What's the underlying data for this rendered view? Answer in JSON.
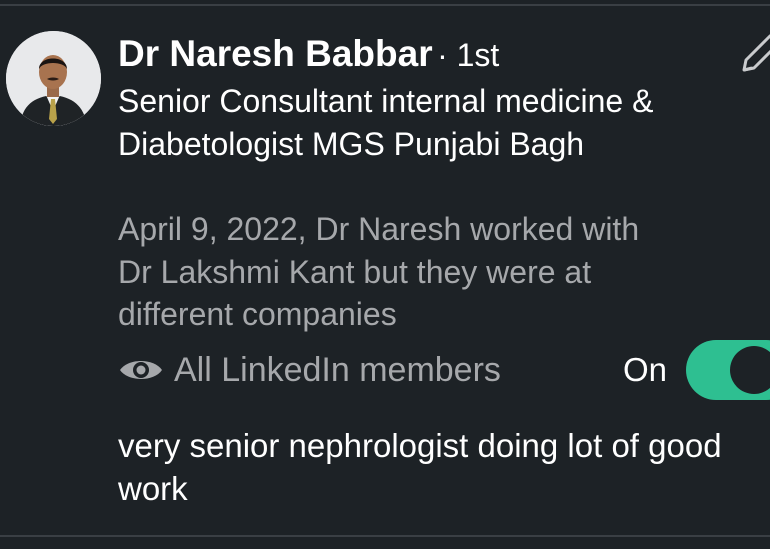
{
  "connection": {
    "name": "Dr Naresh Babbar",
    "degree": "· 1st",
    "headline": "Senior Consultant internal medicine & Diabetologist MGS Punjabi Bagh",
    "context": "April 9, 2022, Dr Naresh worked with Dr Lakshmi Kant but they were at different companies",
    "avatar_icon": "profile-photo",
    "edit_icon": "pencil-icon"
  },
  "visibility": {
    "icon": "eye-icon",
    "label": "All LinkedIn members",
    "toggle_label": "On",
    "toggle_on": true,
    "toggle_color": "#2ebf91"
  },
  "note": {
    "text": "very senior nephrologist doing lot of good work"
  },
  "colors": {
    "background": "#1d2226",
    "primary_text": "#ffffff",
    "secondary_text": "#a6a8ab"
  }
}
